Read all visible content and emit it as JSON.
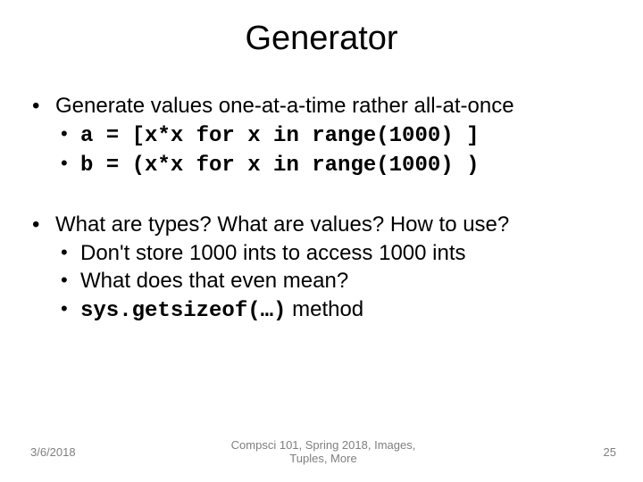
{
  "title": "Generator",
  "bullets": {
    "b1": "Generate values one-at-a-time rather all-at-once",
    "b1a": "a = [x*x for x in range(1000) ]",
    "b1b": "b = (x*x for x in range(1000) )",
    "b2": "What are types? What are values? How to use?",
    "b2a": "Don't store 1000 ints to access 1000 ints",
    "b2b": "What does that even mean?",
    "b2c_code": "sys.getsizeof(…)",
    "b2c_after": " method"
  },
  "footer": {
    "date": "3/6/2018",
    "center_line1": "Compsci 101, Spring 2018,  Images,",
    "center_line2": "Tuples, More",
    "page": "25"
  }
}
